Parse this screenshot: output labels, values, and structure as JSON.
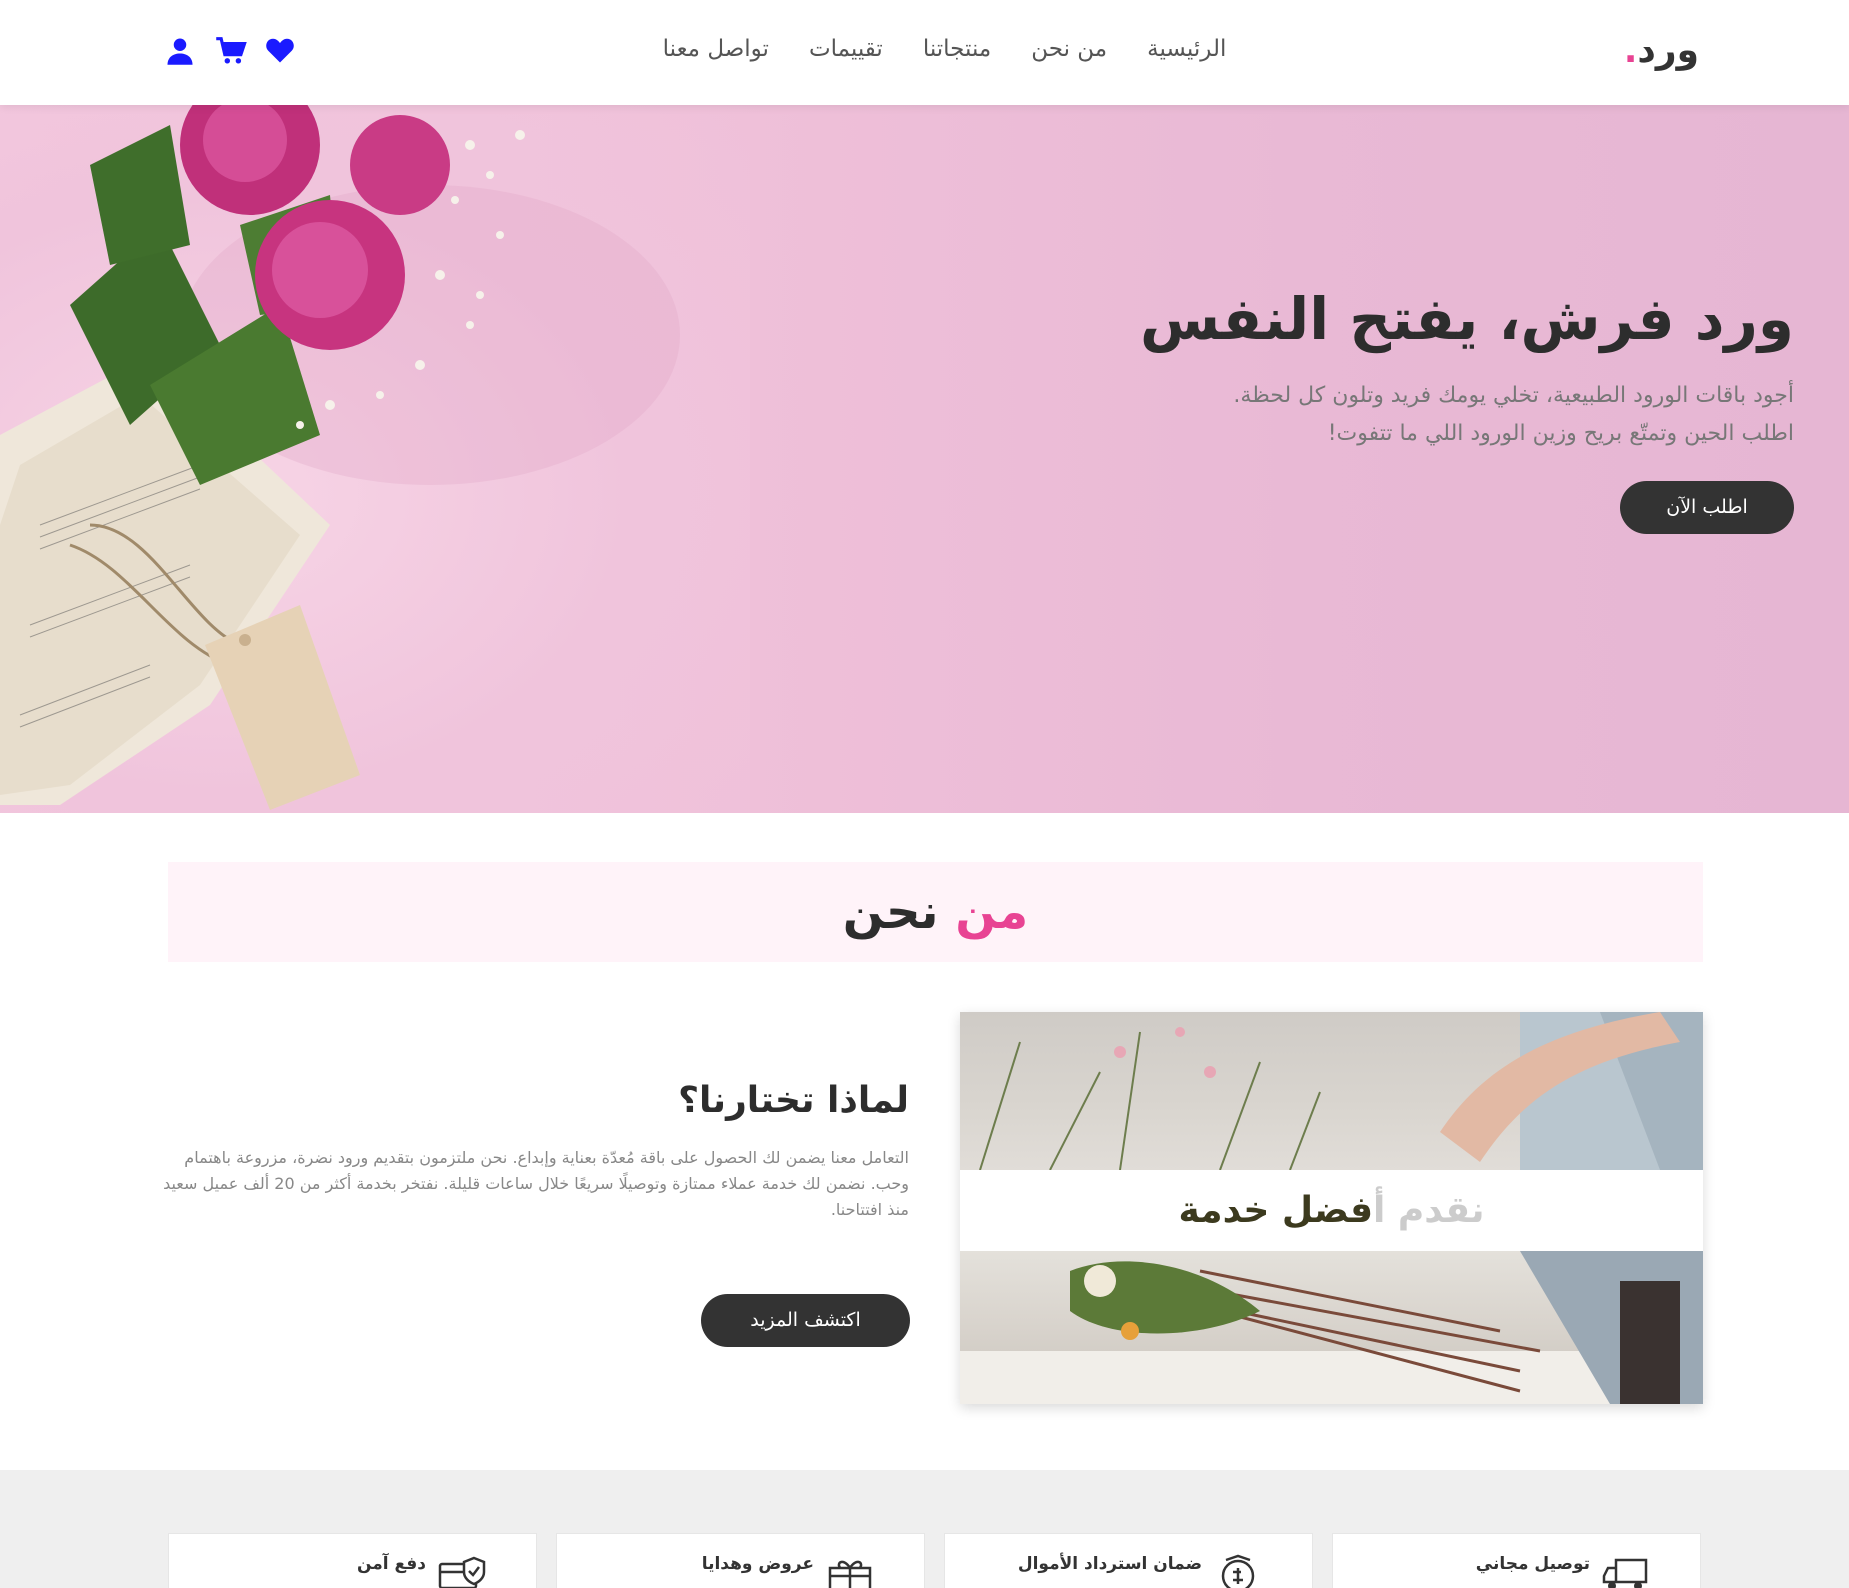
{
  "brand": {
    "name": "ورد",
    "dot": "."
  },
  "nav": {
    "items": [
      "الرئيسية",
      "من نحن",
      "منتجاتنا",
      "تقييمات",
      "تواصل معنا"
    ]
  },
  "icons": [
    "heart-icon",
    "cart-icon",
    "user-icon"
  ],
  "colors": {
    "accent": "#e84393",
    "dark_button": "#333333",
    "nav_icon": "#1a1aff"
  },
  "hero": {
    "title": "ورد فرش، يفتح النفس",
    "line1": "أجود باقات الورود الطبيعية، تخلي يومك فريد وتلون كل لحظة.",
    "line2": "اطلب الحين وتمتّع بريح وزين الورود اللي ما تتفوت!",
    "button": "اطلب الآن"
  },
  "about": {
    "heading_pink": "من",
    "heading_dark": "نحن",
    "banner_faded": "نقدم أ",
    "banner_text": "فضل خدمة",
    "why_title": "لماذا تختارنا؟",
    "why_text": "التعامل معنا يضمن لك الحصول على باقة مُعدّة بعناية وإبداع. نحن ملتزمون بتقديم ورود نضرة، مزروعة باهتمام وحب. نضمن لك خدمة عملاء ممتازة وتوصيلًا سريعًا خلال ساعات قليلة. نفتخر بخدمة أكثر من 20 ألف عميل سعيد منذ افتتاحنا.",
    "button": "اكتشف المزيد"
  },
  "features": [
    {
      "label": "توصيل مجاني",
      "icon": "truck-icon"
    },
    {
      "label": "ضمان استرداد الأموال",
      "icon": "money-back-icon"
    },
    {
      "label": "عروض وهدايا",
      "icon": "gift-icon"
    },
    {
      "label": "دفع آمن",
      "icon": "secure-payment-icon"
    }
  ]
}
